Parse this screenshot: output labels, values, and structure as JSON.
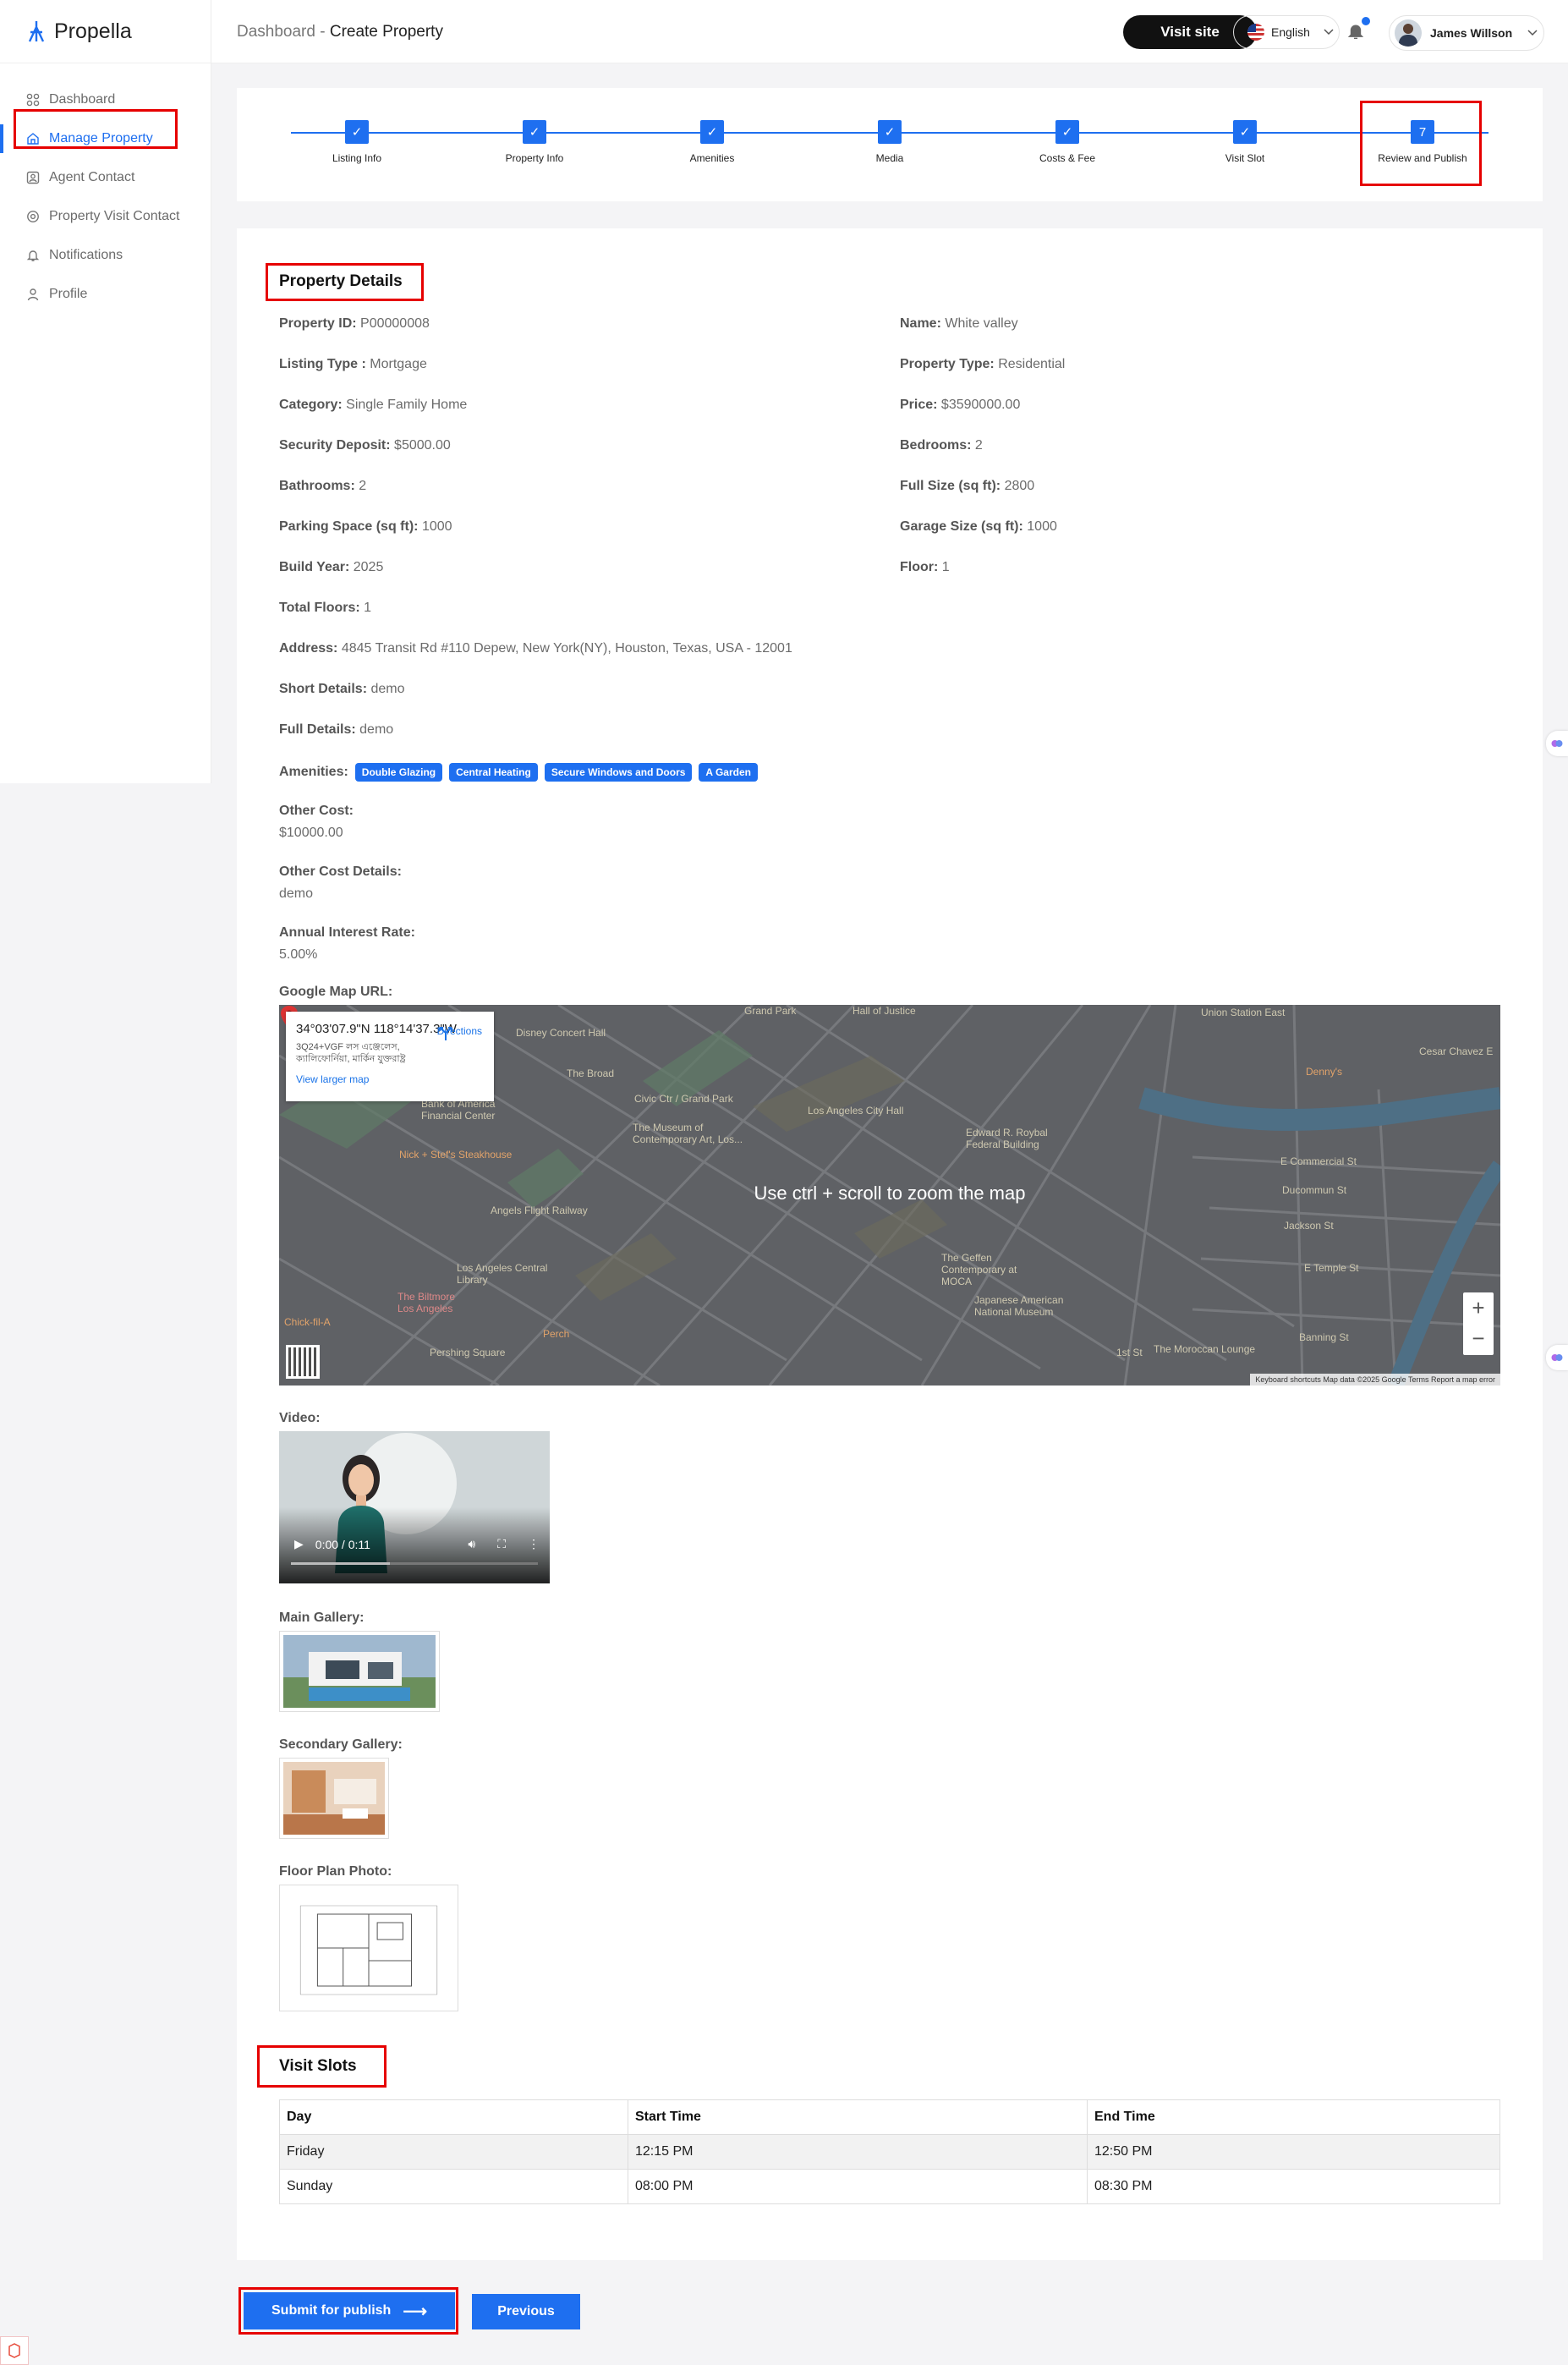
{
  "brand": {
    "name": "Propella"
  },
  "sidebar": {
    "items": [
      {
        "label": "Dashboard",
        "icon": "grid-icon"
      },
      {
        "label": "Manage Property",
        "icon": "home-icon"
      },
      {
        "label": "Agent Contact",
        "icon": "contact-icon"
      },
      {
        "label": "Property Visit Contact",
        "icon": "visit-icon"
      },
      {
        "label": "Notifications",
        "icon": "bell-icon"
      },
      {
        "label": "Profile",
        "icon": "user-icon"
      }
    ]
  },
  "header": {
    "breadcrumb_root": "Dashboard",
    "breadcrumb_sep": "-",
    "breadcrumb_current": "Create Property",
    "visit_site": "Visit site",
    "language": "English",
    "user_name": "James Willson"
  },
  "stepper": {
    "steps": [
      {
        "label": "Listing Info",
        "mark": "✓"
      },
      {
        "label": "Property Info",
        "mark": "✓"
      },
      {
        "label": "Amenities",
        "mark": "✓"
      },
      {
        "label": "Media",
        "mark": "✓"
      },
      {
        "label": "Costs & Fee",
        "mark": "✓"
      },
      {
        "label": "Visit Slot",
        "mark": "✓"
      },
      {
        "label": "Review and Publish",
        "mark": "7"
      }
    ]
  },
  "details": {
    "title": "Property Details",
    "left": [
      {
        "label": "Property ID:",
        "value": "P00000008"
      },
      {
        "label": "Listing Type :",
        "value": "Mortgage"
      },
      {
        "label": "Category:",
        "value": "Single Family Home"
      },
      {
        "label": "Security Deposit:",
        "value": "$5000.00"
      },
      {
        "label": "Bathrooms:",
        "value": "2"
      },
      {
        "label": "Parking Space (sq ft):",
        "value": "1000"
      },
      {
        "label": "Build Year:",
        "value": "2025"
      },
      {
        "label": "Total Floors:",
        "value": "1"
      },
      {
        "label": "Address:",
        "value": "4845 Transit Rd #110 Depew, New York(NY), Houston, Texas, USA - 12001"
      },
      {
        "label": "Short Details:",
        "value": "demo"
      },
      {
        "label": "Full Details:",
        "value": "demo"
      }
    ],
    "right": [
      {
        "label": "Name:",
        "value": "White valley"
      },
      {
        "label": "Property Type:",
        "value": "Residential"
      },
      {
        "label": "Price:",
        "value": "$3590000.00"
      },
      {
        "label": "Bedrooms:",
        "value": "2"
      },
      {
        "label": "Full Size (sq ft):",
        "value": "2800"
      },
      {
        "label": "Garage Size (sq ft):",
        "value": "1000"
      },
      {
        "label": "Floor:",
        "value": "1"
      }
    ],
    "amenities_label": "Amenities:",
    "amenities": [
      "Double Glazing",
      "Central Heating",
      "Secure Windows and Doors",
      "A Garden"
    ],
    "other_cost_label": "Other Cost:",
    "other_cost": "$10000.00",
    "other_cost_details_label": "Other Cost Details:",
    "other_cost_details": "demo",
    "interest_label": "Annual Interest Rate:",
    "interest": "5.00%",
    "map_label": "Google Map URL:",
    "video_label": "Video:",
    "main_gallery_label": "Main Gallery:",
    "secondary_gallery_label": "Secondary Gallery:",
    "floor_plan_label": "Floor Plan Photo:"
  },
  "map": {
    "coords": "34°03'07.9\"N 118°14'37.3\"W",
    "plus_code": "3Q24+VGF লস এঞ্জেলেস, ক্যালিফোর্নিয়া, মার্কিন যুক্তরাষ্ট্র",
    "larger": "View larger map",
    "directions": "Directions",
    "overlay": "Use ctrl + scroll to zoom the map",
    "footer": "Keyboard shortcuts   Map data ©2025 Google   Terms   Report a map error",
    "places": [
      "Civic Ctr / Grand Park",
      "Los Angeles City Hall",
      "The Broad",
      "Angels Flight Railway",
      "Los Angeles Central Library",
      "The Museum of Contemporary Art, Los...",
      "Edward R. Roybal Federal Building",
      "Pershing Square",
      "The Geffen Contemporary at MOCA",
      "Japanese American National Museum",
      "Union Station East",
      "The Moroccan Lounge",
      "Nick + Stef's Steakhouse",
      "The Biltmore Los Angeles",
      "Bank of America Financial Center",
      "Hall of Justice",
      "Grand Park",
      "Chick-fil-A",
      "Perch",
      "E Commercial St",
      "Ducommun St",
      "Jackson St",
      "E Temple St",
      "Banning St",
      "Cesar Chavez E",
      "Denny's",
      "1st St",
      "Disney Concert Hall"
    ]
  },
  "video": {
    "time": "0:00 / 0:11",
    "progress": 0.4
  },
  "visit_slots": {
    "title": "Visit Slots",
    "headers": [
      "Day",
      "Start Time",
      "End Time"
    ],
    "rows": [
      [
        "Friday",
        "12:15 PM",
        "12:50 PM"
      ],
      [
        "Sunday",
        "08:00 PM",
        "08:30 PM"
      ]
    ]
  },
  "actions": {
    "submit": "Submit for publish",
    "submit_arrow": "⟶",
    "previous": "Previous"
  },
  "colors": {
    "accent": "#1e6ff0",
    "highlight": "#e60000"
  }
}
